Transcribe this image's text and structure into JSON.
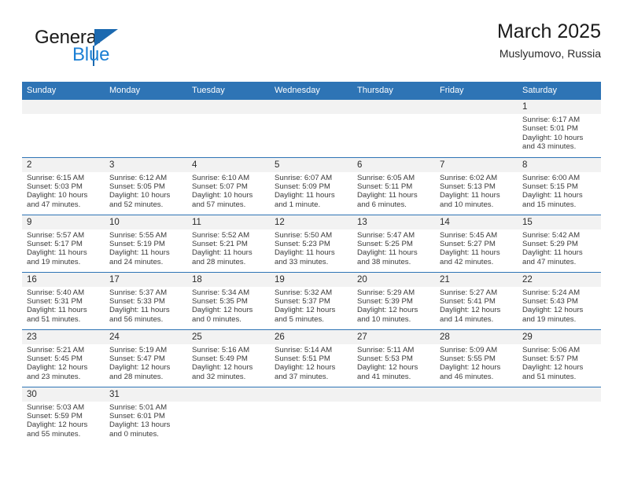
{
  "brand": {
    "name_part1": "General",
    "name_part2": "Blue",
    "triangle_icon": "triangle-icon",
    "accent_dark": "#1b69b0",
    "accent_light": "#1b7fd4"
  },
  "header": {
    "title": "March 2025",
    "subtitle": "Muslyumovo, Russia",
    "header_bg": "#2e74b5",
    "daynum_bg": "#f2f2f2"
  },
  "weekday_headers": [
    "Sunday",
    "Monday",
    "Tuesday",
    "Wednesday",
    "Thursday",
    "Friday",
    "Saturday"
  ],
  "labels": {
    "sunrise": "Sunrise:",
    "sunset": "Sunset:",
    "daylight": "Daylight:"
  },
  "weeks": [
    [
      {
        "day": "",
        "sunrise": "",
        "sunset": "",
        "daylight_a": "",
        "daylight_b": ""
      },
      {
        "day": "",
        "sunrise": "",
        "sunset": "",
        "daylight_a": "",
        "daylight_b": ""
      },
      {
        "day": "",
        "sunrise": "",
        "sunset": "",
        "daylight_a": "",
        "daylight_b": ""
      },
      {
        "day": "",
        "sunrise": "",
        "sunset": "",
        "daylight_a": "",
        "daylight_b": ""
      },
      {
        "day": "",
        "sunrise": "",
        "sunset": "",
        "daylight_a": "",
        "daylight_b": ""
      },
      {
        "day": "",
        "sunrise": "",
        "sunset": "",
        "daylight_a": "",
        "daylight_b": ""
      },
      {
        "day": "1",
        "sunrise": "Sunrise: 6:17 AM",
        "sunset": "Sunset: 5:01 PM",
        "daylight_a": "Daylight: 10 hours",
        "daylight_b": "and 43 minutes."
      }
    ],
    [
      {
        "day": "2",
        "sunrise": "Sunrise: 6:15 AM",
        "sunset": "Sunset: 5:03 PM",
        "daylight_a": "Daylight: 10 hours",
        "daylight_b": "and 47 minutes."
      },
      {
        "day": "3",
        "sunrise": "Sunrise: 6:12 AM",
        "sunset": "Sunset: 5:05 PM",
        "daylight_a": "Daylight: 10 hours",
        "daylight_b": "and 52 minutes."
      },
      {
        "day": "4",
        "sunrise": "Sunrise: 6:10 AM",
        "sunset": "Sunset: 5:07 PM",
        "daylight_a": "Daylight: 10 hours",
        "daylight_b": "and 57 minutes."
      },
      {
        "day": "5",
        "sunrise": "Sunrise: 6:07 AM",
        "sunset": "Sunset: 5:09 PM",
        "daylight_a": "Daylight: 11 hours",
        "daylight_b": "and 1 minute."
      },
      {
        "day": "6",
        "sunrise": "Sunrise: 6:05 AM",
        "sunset": "Sunset: 5:11 PM",
        "daylight_a": "Daylight: 11 hours",
        "daylight_b": "and 6 minutes."
      },
      {
        "day": "7",
        "sunrise": "Sunrise: 6:02 AM",
        "sunset": "Sunset: 5:13 PM",
        "daylight_a": "Daylight: 11 hours",
        "daylight_b": "and 10 minutes."
      },
      {
        "day": "8",
        "sunrise": "Sunrise: 6:00 AM",
        "sunset": "Sunset: 5:15 PM",
        "daylight_a": "Daylight: 11 hours",
        "daylight_b": "and 15 minutes."
      }
    ],
    [
      {
        "day": "9",
        "sunrise": "Sunrise: 5:57 AM",
        "sunset": "Sunset: 5:17 PM",
        "daylight_a": "Daylight: 11 hours",
        "daylight_b": "and 19 minutes."
      },
      {
        "day": "10",
        "sunrise": "Sunrise: 5:55 AM",
        "sunset": "Sunset: 5:19 PM",
        "daylight_a": "Daylight: 11 hours",
        "daylight_b": "and 24 minutes."
      },
      {
        "day": "11",
        "sunrise": "Sunrise: 5:52 AM",
        "sunset": "Sunset: 5:21 PM",
        "daylight_a": "Daylight: 11 hours",
        "daylight_b": "and 28 minutes."
      },
      {
        "day": "12",
        "sunrise": "Sunrise: 5:50 AM",
        "sunset": "Sunset: 5:23 PM",
        "daylight_a": "Daylight: 11 hours",
        "daylight_b": "and 33 minutes."
      },
      {
        "day": "13",
        "sunrise": "Sunrise: 5:47 AM",
        "sunset": "Sunset: 5:25 PM",
        "daylight_a": "Daylight: 11 hours",
        "daylight_b": "and 38 minutes."
      },
      {
        "day": "14",
        "sunrise": "Sunrise: 5:45 AM",
        "sunset": "Sunset: 5:27 PM",
        "daylight_a": "Daylight: 11 hours",
        "daylight_b": "and 42 minutes."
      },
      {
        "day": "15",
        "sunrise": "Sunrise: 5:42 AM",
        "sunset": "Sunset: 5:29 PM",
        "daylight_a": "Daylight: 11 hours",
        "daylight_b": "and 47 minutes."
      }
    ],
    [
      {
        "day": "16",
        "sunrise": "Sunrise: 5:40 AM",
        "sunset": "Sunset: 5:31 PM",
        "daylight_a": "Daylight: 11 hours",
        "daylight_b": "and 51 minutes."
      },
      {
        "day": "17",
        "sunrise": "Sunrise: 5:37 AM",
        "sunset": "Sunset: 5:33 PM",
        "daylight_a": "Daylight: 11 hours",
        "daylight_b": "and 56 minutes."
      },
      {
        "day": "18",
        "sunrise": "Sunrise: 5:34 AM",
        "sunset": "Sunset: 5:35 PM",
        "daylight_a": "Daylight: 12 hours",
        "daylight_b": "and 0 minutes."
      },
      {
        "day": "19",
        "sunrise": "Sunrise: 5:32 AM",
        "sunset": "Sunset: 5:37 PM",
        "daylight_a": "Daylight: 12 hours",
        "daylight_b": "and 5 minutes."
      },
      {
        "day": "20",
        "sunrise": "Sunrise: 5:29 AM",
        "sunset": "Sunset: 5:39 PM",
        "daylight_a": "Daylight: 12 hours",
        "daylight_b": "and 10 minutes."
      },
      {
        "day": "21",
        "sunrise": "Sunrise: 5:27 AM",
        "sunset": "Sunset: 5:41 PM",
        "daylight_a": "Daylight: 12 hours",
        "daylight_b": "and 14 minutes."
      },
      {
        "day": "22",
        "sunrise": "Sunrise: 5:24 AM",
        "sunset": "Sunset: 5:43 PM",
        "daylight_a": "Daylight: 12 hours",
        "daylight_b": "and 19 minutes."
      }
    ],
    [
      {
        "day": "23",
        "sunrise": "Sunrise: 5:21 AM",
        "sunset": "Sunset: 5:45 PM",
        "daylight_a": "Daylight: 12 hours",
        "daylight_b": "and 23 minutes."
      },
      {
        "day": "24",
        "sunrise": "Sunrise: 5:19 AM",
        "sunset": "Sunset: 5:47 PM",
        "daylight_a": "Daylight: 12 hours",
        "daylight_b": "and 28 minutes."
      },
      {
        "day": "25",
        "sunrise": "Sunrise: 5:16 AM",
        "sunset": "Sunset: 5:49 PM",
        "daylight_a": "Daylight: 12 hours",
        "daylight_b": "and 32 minutes."
      },
      {
        "day": "26",
        "sunrise": "Sunrise: 5:14 AM",
        "sunset": "Sunset: 5:51 PM",
        "daylight_a": "Daylight: 12 hours",
        "daylight_b": "and 37 minutes."
      },
      {
        "day": "27",
        "sunrise": "Sunrise: 5:11 AM",
        "sunset": "Sunset: 5:53 PM",
        "daylight_a": "Daylight: 12 hours",
        "daylight_b": "and 41 minutes."
      },
      {
        "day": "28",
        "sunrise": "Sunrise: 5:09 AM",
        "sunset": "Sunset: 5:55 PM",
        "daylight_a": "Daylight: 12 hours",
        "daylight_b": "and 46 minutes."
      },
      {
        "day": "29",
        "sunrise": "Sunrise: 5:06 AM",
        "sunset": "Sunset: 5:57 PM",
        "daylight_a": "Daylight: 12 hours",
        "daylight_b": "and 51 minutes."
      }
    ],
    [
      {
        "day": "30",
        "sunrise": "Sunrise: 5:03 AM",
        "sunset": "Sunset: 5:59 PM",
        "daylight_a": "Daylight: 12 hours",
        "daylight_b": "and 55 minutes."
      },
      {
        "day": "31",
        "sunrise": "Sunrise: 5:01 AM",
        "sunset": "Sunset: 6:01 PM",
        "daylight_a": "Daylight: 13 hours",
        "daylight_b": "and 0 minutes."
      },
      {
        "day": "",
        "sunrise": "",
        "sunset": "",
        "daylight_a": "",
        "daylight_b": ""
      },
      {
        "day": "",
        "sunrise": "",
        "sunset": "",
        "daylight_a": "",
        "daylight_b": ""
      },
      {
        "day": "",
        "sunrise": "",
        "sunset": "",
        "daylight_a": "",
        "daylight_b": ""
      },
      {
        "day": "",
        "sunrise": "",
        "sunset": "",
        "daylight_a": "",
        "daylight_b": ""
      },
      {
        "day": "",
        "sunrise": "",
        "sunset": "",
        "daylight_a": "",
        "daylight_b": ""
      }
    ]
  ]
}
